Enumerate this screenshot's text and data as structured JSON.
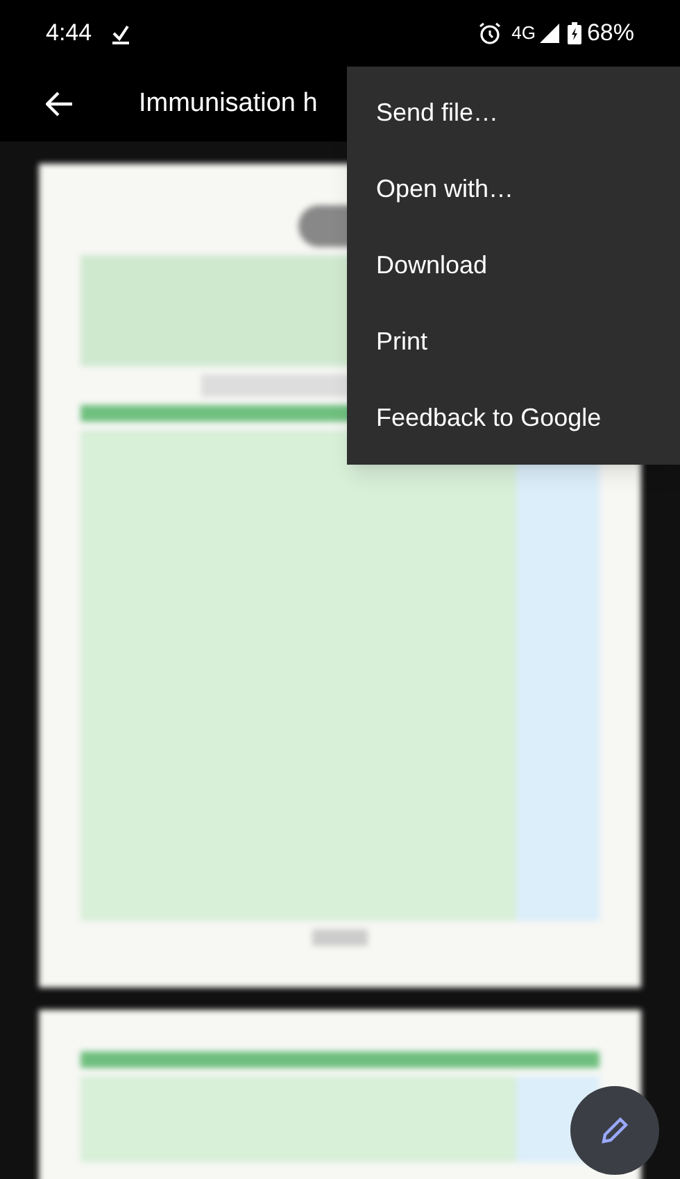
{
  "status_bar": {
    "time": "4:44",
    "network": "4G",
    "battery": "68%"
  },
  "app_bar": {
    "title": "Immunisation h"
  },
  "menu": {
    "items": [
      {
        "label": "Send file…"
      },
      {
        "label": "Open with…"
      },
      {
        "label": "Download"
      },
      {
        "label": "Print"
      },
      {
        "label": "Feedback to Google"
      }
    ]
  }
}
